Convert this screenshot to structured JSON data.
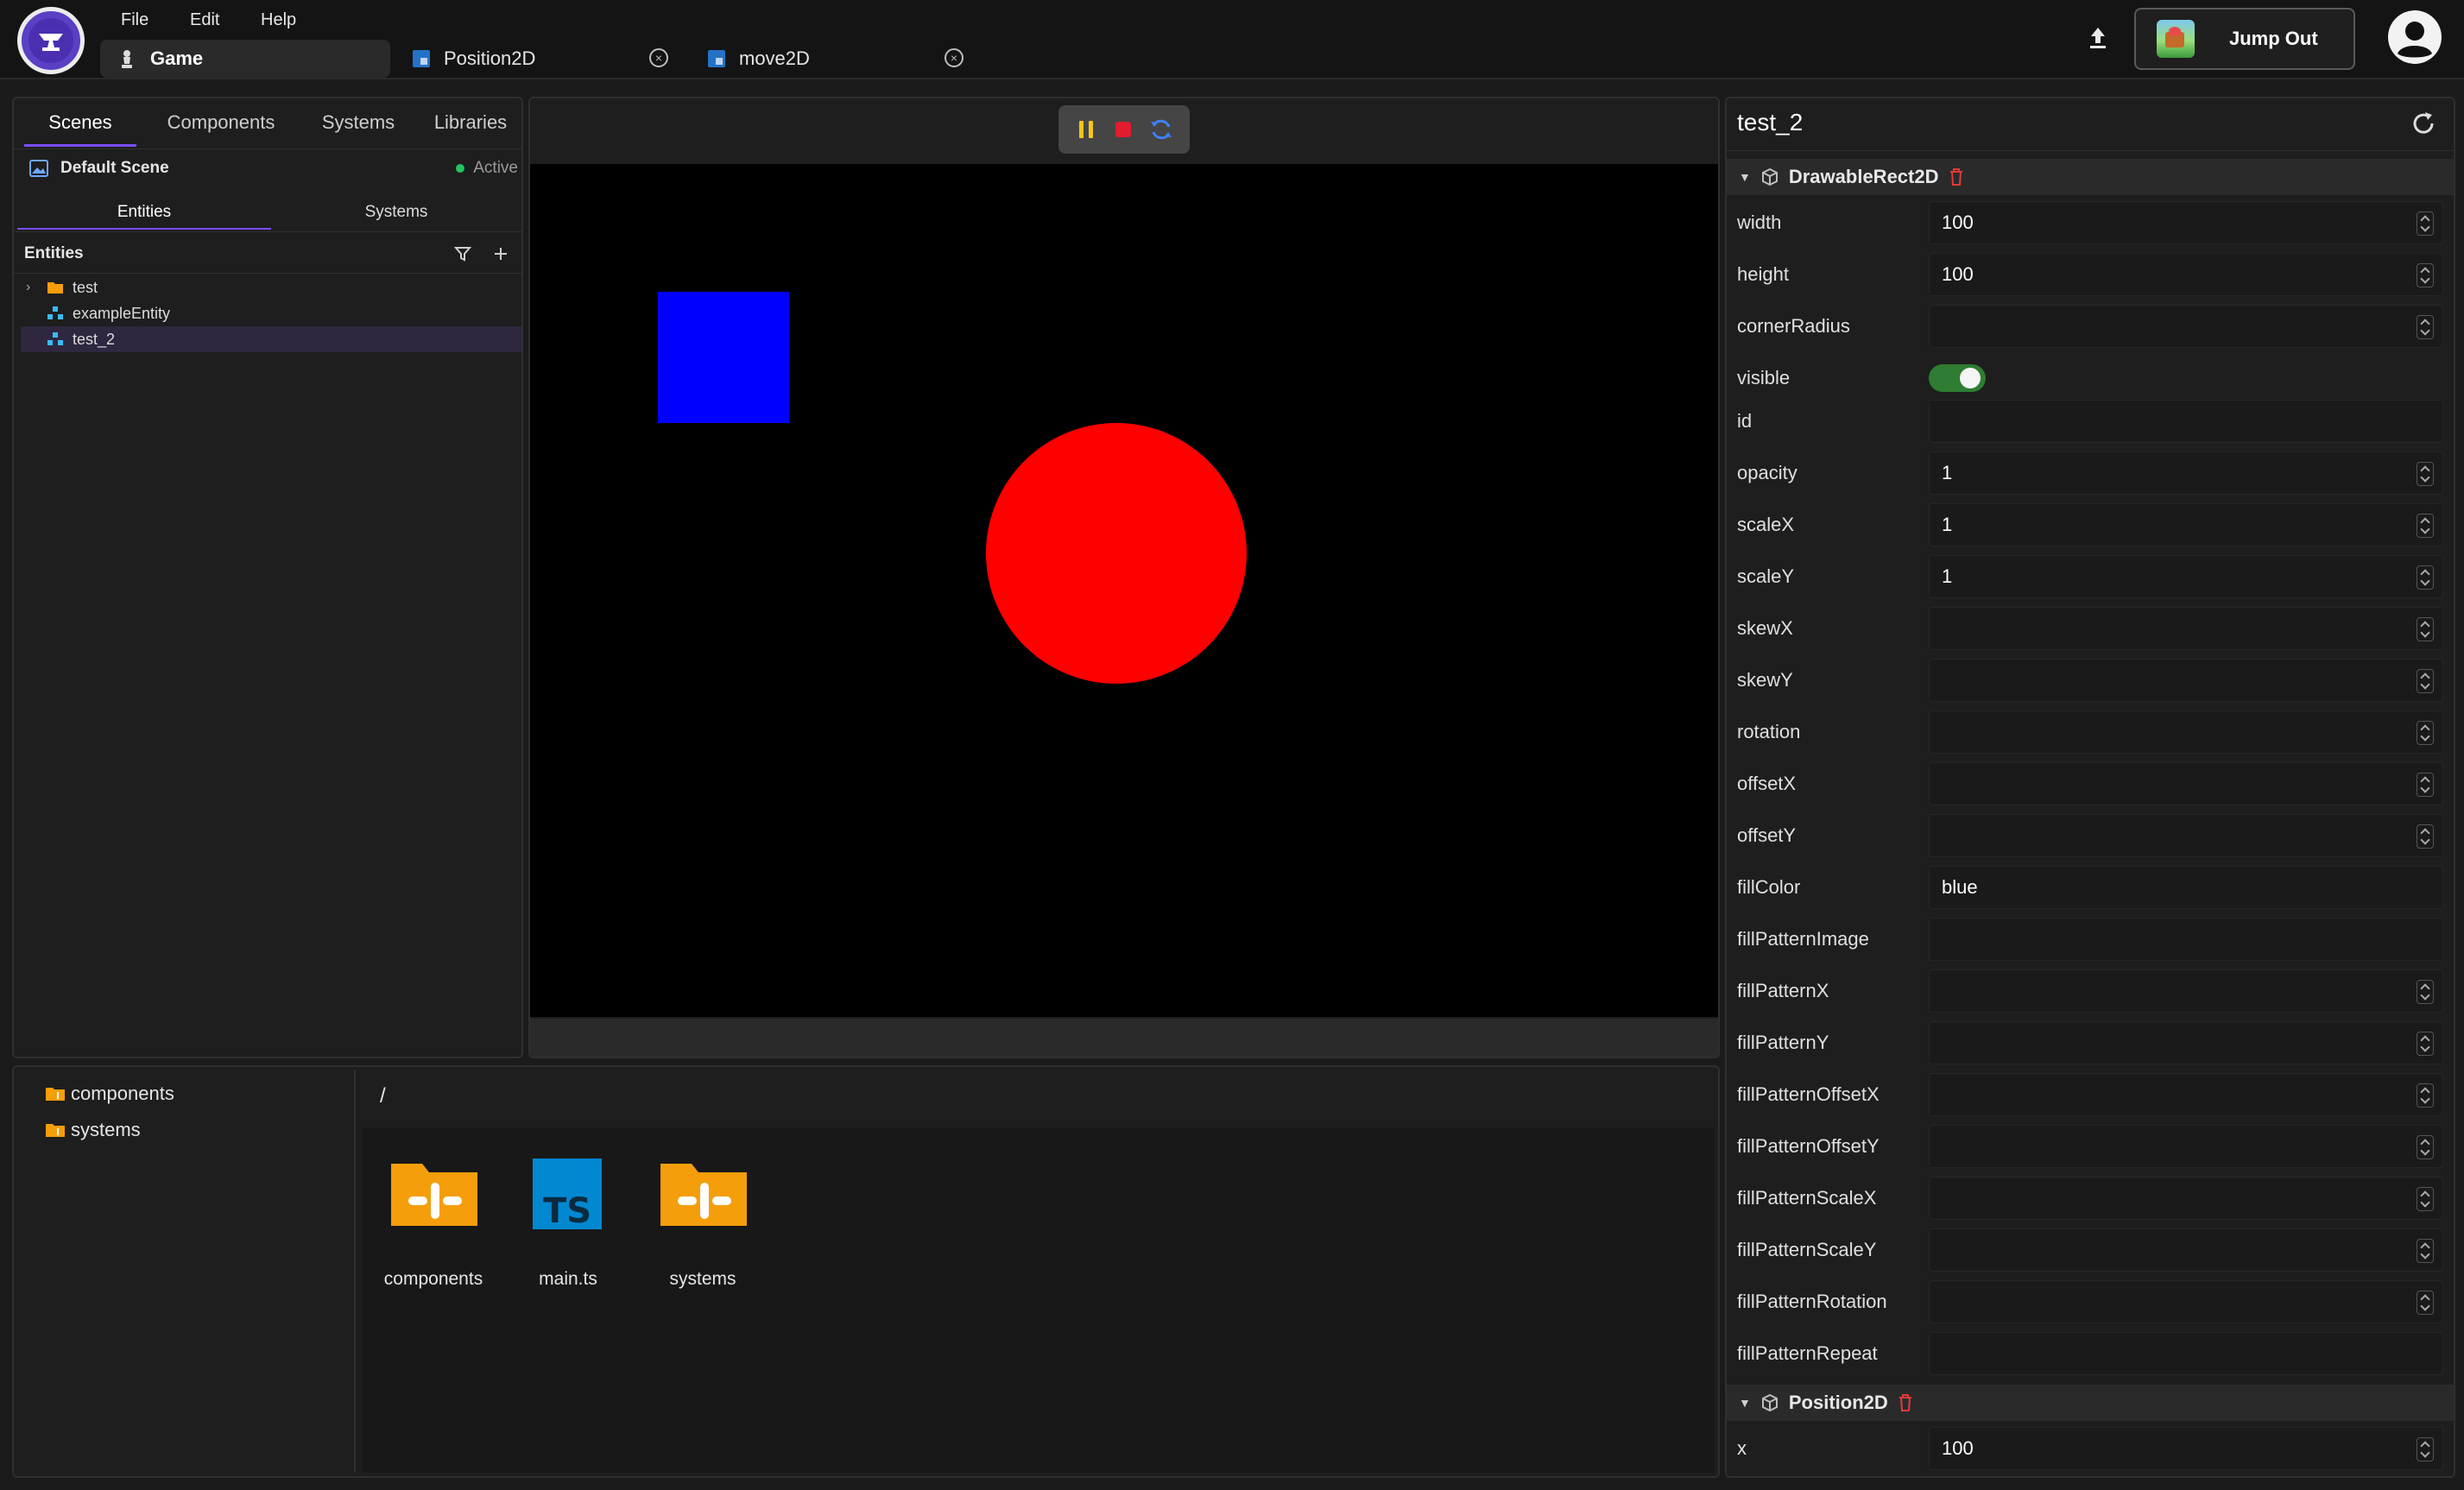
{
  "menu": {
    "file": "File",
    "edit": "Edit",
    "help": "Help"
  },
  "doc_tabs": [
    {
      "label": "Game",
      "icon": "chess-piece-icon",
      "active": true
    },
    {
      "label": "Position2D",
      "icon": "ts-file-icon"
    },
    {
      "label": "move2D",
      "icon": "ts-file-icon"
    }
  ],
  "topbar": {
    "jump_out_label": "Jump Out",
    "upload_icon": "upload-icon",
    "avatar_icon": "user-avatar-icon"
  },
  "left_panel": {
    "tabs": [
      "Scenes",
      "Components",
      "Systems",
      "Libraries"
    ],
    "scene": {
      "name": "Default Scene",
      "status": "Active",
      "status_color": "#22c55e"
    },
    "sub_tabs": [
      "Entities",
      "Systems"
    ],
    "entities_title": "Entities",
    "tree": [
      {
        "label": "test",
        "type": "folder"
      },
      {
        "label": "exampleEntity",
        "type": "entity"
      },
      {
        "label": "test_2",
        "type": "entity",
        "selected": true
      }
    ]
  },
  "viewport": {
    "controls": [
      "pause-icon",
      "stop-icon",
      "reload-icon"
    ],
    "objects": [
      {
        "shape": "rect",
        "color": "#0000ff"
      },
      {
        "shape": "circle",
        "color": "#ff0000"
      }
    ]
  },
  "inspector": {
    "title": "test_2",
    "components": [
      {
        "name": "DrawableRect2D",
        "props": [
          {
            "label": "width",
            "value": "100",
            "stepper": true
          },
          {
            "label": "height",
            "value": "100",
            "stepper": true
          },
          {
            "label": "cornerRadius",
            "value": "",
            "stepper": true
          },
          {
            "label": "visible",
            "toggle": true,
            "on": true
          },
          {
            "label": "id",
            "value": "",
            "stepper": false
          },
          {
            "label": "opacity",
            "value": "1",
            "stepper": true
          },
          {
            "label": "scaleX",
            "value": "1",
            "stepper": true
          },
          {
            "label": "scaleY",
            "value": "1",
            "stepper": true
          },
          {
            "label": "skewX",
            "value": "",
            "stepper": true
          },
          {
            "label": "skewY",
            "value": "",
            "stepper": true
          },
          {
            "label": "rotation",
            "value": "",
            "stepper": true
          },
          {
            "label": "offsetX",
            "value": "",
            "stepper": true
          },
          {
            "label": "offsetY",
            "value": "",
            "stepper": true
          },
          {
            "label": "fillColor",
            "value": "blue",
            "stepper": false
          },
          {
            "label": "fillPatternImage",
            "value": "",
            "stepper": false
          },
          {
            "label": "fillPatternX",
            "value": "",
            "stepper": true
          },
          {
            "label": "fillPatternY",
            "value": "",
            "stepper": true
          },
          {
            "label": "fillPatternOffsetX",
            "value": "",
            "stepper": true
          },
          {
            "label": "fillPatternOffsetY",
            "value": "",
            "stepper": true
          },
          {
            "label": "fillPatternScaleX",
            "value": "",
            "stepper": true
          },
          {
            "label": "fillPatternScaleY",
            "value": "",
            "stepper": true
          },
          {
            "label": "fillPatternRotation",
            "value": "",
            "stepper": true
          },
          {
            "label": "fillPatternRepeat",
            "value": "",
            "stepper": false
          }
        ]
      },
      {
        "name": "Position2D",
        "props": [
          {
            "label": "x",
            "value": "100",
            "stepper": true
          }
        ]
      }
    ]
  },
  "file_browser": {
    "folders": [
      "components",
      "systems"
    ],
    "path": "/",
    "files": [
      {
        "label": "components",
        "type": "folder"
      },
      {
        "label": "main.ts",
        "type": "ts"
      },
      {
        "label": "systems",
        "type": "folder"
      }
    ]
  },
  "colors": {
    "accent": "#7c4dff",
    "folder": "#f59e0b",
    "ts": "#0288d1",
    "danger": "#e53935",
    "toggle_on": "#2e7d32"
  }
}
